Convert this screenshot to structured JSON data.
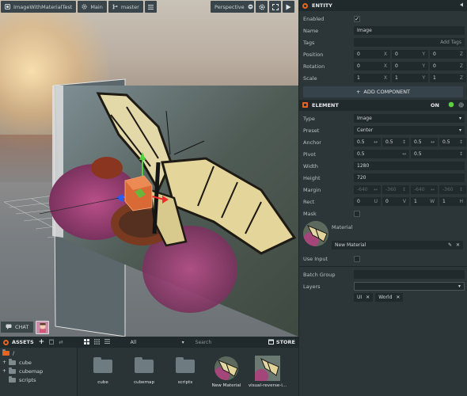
{
  "viewport": {
    "toolbar_left": {
      "scene_name": "ImageWithMaterialTest",
      "scene": "Main",
      "branch": "master"
    },
    "toolbar_right": {
      "camera": "Perspective"
    },
    "chat_label": "CHAT"
  },
  "inspector": {
    "entity": {
      "title": "ENTITY",
      "enabled_label": "Enabled",
      "name_label": "Name",
      "name_value": "Image",
      "tags_label": "Tags",
      "add_tags": "Add Tags",
      "position_label": "Position",
      "position": {
        "x": "0",
        "y": "0",
        "z": "0"
      },
      "rotation_label": "Rotation",
      "rotation": {
        "x": "0",
        "y": "0",
        "z": "0"
      },
      "scale_label": "Scale",
      "scale": {
        "x": "1",
        "y": "1",
        "z": "1"
      },
      "axis_x": "X",
      "axis_y": "Y",
      "axis_z": "Z",
      "add_component": "ADD COMPONENT"
    },
    "element": {
      "title": "ELEMENT",
      "on_label": "ON",
      "type_label": "Type",
      "type_value": "Image",
      "preset_label": "Preset",
      "preset_value": "Center",
      "anchor_label": "Anchor",
      "anchor": [
        "0.5",
        "0.5",
        "0.5",
        "0.5"
      ],
      "pivot_label": "Pivot",
      "pivot": [
        "0.5",
        "0.5"
      ],
      "width_label": "Width",
      "width_value": "1280",
      "height_label": "Height",
      "height_value": "720",
      "margin_label": "Margin",
      "margin": [
        "-640",
        "-360",
        "-640",
        "-360"
      ],
      "rect_label": "Rect",
      "rect": [
        {
          "v": "0",
          "a": "U"
        },
        {
          "v": "0",
          "a": "V"
        },
        {
          "v": "1",
          "a": "W"
        },
        {
          "v": "1",
          "a": "H"
        }
      ],
      "mask_label": "Mask",
      "material_label": "Material",
      "material_name": "New Material",
      "use_input_label": "Use Input",
      "batch_group_label": "Batch Group",
      "layers_label": "Layers",
      "layers": [
        "UI",
        "World"
      ]
    }
  },
  "assets": {
    "title": "ASSETS",
    "filter": "All",
    "search_placeholder": "Search",
    "store": "STORE",
    "tree_root": "/",
    "tree": [
      "cube",
      "cubemap",
      "scripts"
    ],
    "items": [
      {
        "name": "cube",
        "kind": "folder"
      },
      {
        "name": "cubemap",
        "kind": "folder"
      },
      {
        "name": "scripts",
        "kind": "folder"
      },
      {
        "name": "New Material",
        "kind": "material"
      },
      {
        "name": "visual-reverse-i...",
        "kind": "texture"
      }
    ]
  },
  "colors": {
    "accent": "#e8641d",
    "toggle_on": "#5ccf41",
    "panel": "#2c3639"
  }
}
